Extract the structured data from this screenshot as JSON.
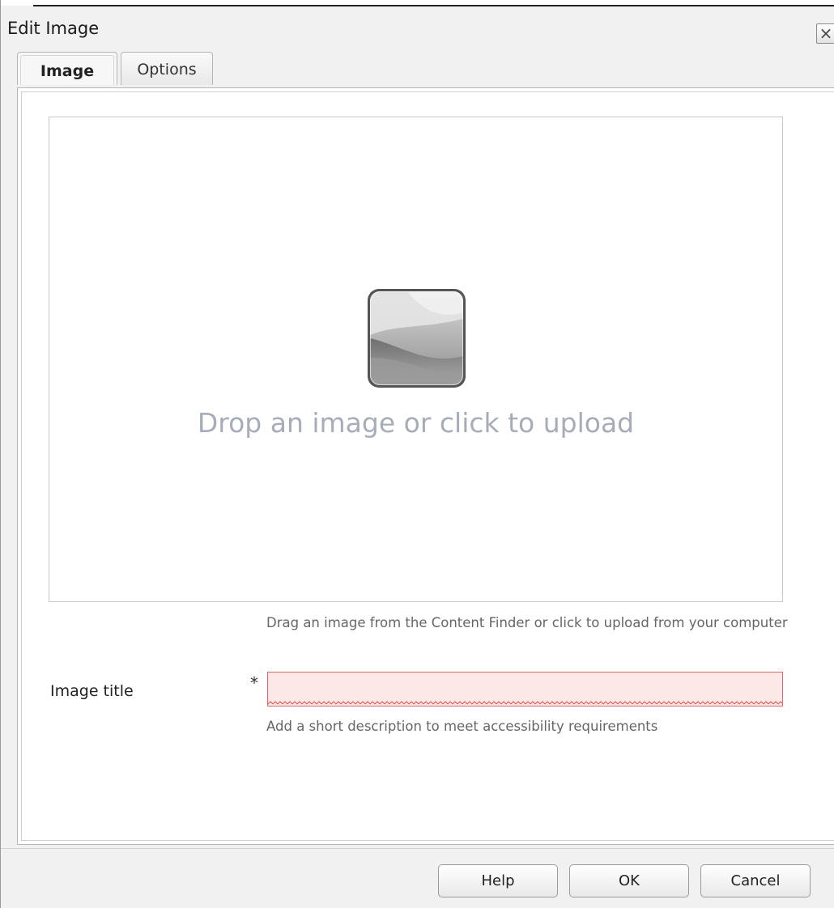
{
  "dialog": {
    "title": "Edit Image",
    "close_label": "×"
  },
  "tabs": [
    {
      "label": "Image",
      "active": true
    },
    {
      "label": "Options",
      "active": false
    }
  ],
  "dropzone": {
    "icon": "image-placeholder-icon",
    "text": "Drop an image or click to upload",
    "help": "Drag an image from the Content Finder or click to upload from your computer"
  },
  "form": {
    "image_title": {
      "label": "Image title",
      "required_marker": "*",
      "value": "",
      "help": "Add a short description to meet accessibility requirements",
      "invalid": true
    }
  },
  "buttons": {
    "help": "Help",
    "ok": "OK",
    "cancel": "Cancel"
  },
  "colors": {
    "invalid_border": "#e06666",
    "invalid_fill": "#fde8e8",
    "drop_text": "#a6adb9"
  }
}
